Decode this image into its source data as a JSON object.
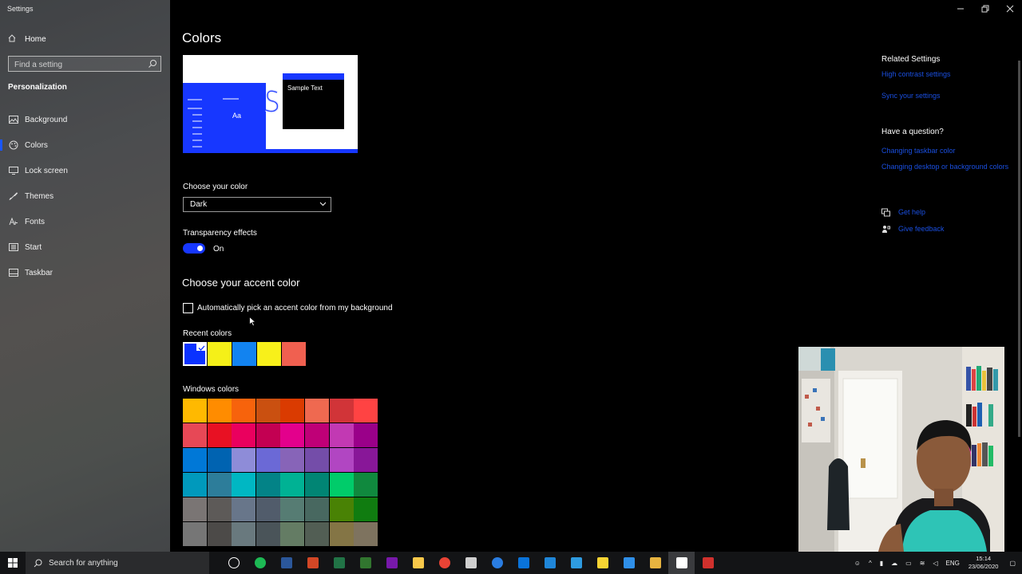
{
  "window": {
    "title": "Settings",
    "controls": [
      "minimize",
      "restore",
      "close"
    ]
  },
  "sidebar": {
    "home_label": "Home",
    "search_placeholder": "Find a setting",
    "section_label": "Personalization",
    "items": [
      {
        "label": "Background",
        "icon": "picture-icon"
      },
      {
        "label": "Colors",
        "icon": "palette-icon"
      },
      {
        "label": "Lock screen",
        "icon": "monitor-icon"
      },
      {
        "label": "Themes",
        "icon": "brush-icon"
      },
      {
        "label": "Fonts",
        "icon": "font-icon"
      },
      {
        "label": "Start",
        "icon": "start-menu-icon"
      },
      {
        "label": "Taskbar",
        "icon": "taskbar-icon"
      }
    ],
    "active_item": "Colors"
  },
  "main": {
    "title": "Colors",
    "preview": {
      "sample_text": "Sample Text",
      "aa_text": "Aa"
    },
    "choose_color": {
      "label": "Choose your color",
      "value": "Dark"
    },
    "transparency": {
      "label": "Transparency effects",
      "state": "On"
    },
    "accent": {
      "heading": "Choose your accent color",
      "auto_pick_label": "Automatically pick an accent color from my background",
      "auto_pick_checked": false,
      "recent_label": "Recent colors",
      "recent_colors": [
        "#0a32ff",
        "#f5f018",
        "#1283f0",
        "#f8f01a",
        "#f06050"
      ],
      "selected_recent_index": 0,
      "windows_label": "Windows colors",
      "windows_colors": [
        [
          "#ffb900",
          "#ff8c00",
          "#f7630c",
          "#ca5010",
          "#da3b01",
          "#ef6950",
          "#d13438",
          "#ff4343"
        ],
        [
          "#e74856",
          "#e81123",
          "#ea005e",
          "#c30052",
          "#e3008c",
          "#bf0077",
          "#c239b3",
          "#9a0089"
        ],
        [
          "#0078d7",
          "#0063b1",
          "#8e8cd8",
          "#6b69d6",
          "#8764b8",
          "#744da9",
          "#b146c2",
          "#881798"
        ],
        [
          "#0099bc",
          "#2d7d9a",
          "#00b7c3",
          "#038387",
          "#00b294",
          "#018574",
          "#00cc6a",
          "#10893e"
        ],
        [
          "#7a7574",
          "#5d5a58",
          "#68768a",
          "#515c6b",
          "#567c73",
          "#486860",
          "#498205",
          "#107c10"
        ],
        [
          "#767676",
          "#4c4a48",
          "#69797e",
          "#4a5459",
          "#647c64",
          "#525e54",
          "#847545",
          "#7e735f"
        ]
      ]
    }
  },
  "related": {
    "heading": "Related Settings",
    "links": [
      "High contrast settings",
      "Sync your settings"
    ],
    "question_heading": "Have a question?",
    "question_links": [
      "Changing taskbar color",
      "Changing desktop or background colors"
    ],
    "help_link": "Get help",
    "feedback_link": "Give feedback",
    "link_color": "#1a4fe0"
  },
  "taskbar": {
    "search_text": "Search for anything",
    "apps": [
      {
        "name": "cortana-icon",
        "color": "#ffffff"
      },
      {
        "name": "spotify-icon",
        "color": "#1db954"
      },
      {
        "name": "word-icon",
        "color": "#2b579a"
      },
      {
        "name": "powerpoint-icon",
        "color": "#d24726"
      },
      {
        "name": "excel-icon",
        "color": "#217346"
      },
      {
        "name": "project-icon",
        "color": "#31752f"
      },
      {
        "name": "onenote-icon",
        "color": "#7719aa"
      },
      {
        "name": "file-explorer-icon",
        "color": "#f8c84a"
      },
      {
        "name": "chrome-icon",
        "color": "#e94335"
      },
      {
        "name": "snip-icon",
        "color": "#cfcfcf"
      },
      {
        "name": "compass-icon",
        "color": "#2a7de1"
      },
      {
        "name": "store-icon",
        "color": "#0a73d9"
      },
      {
        "name": "window-app-icon",
        "color": "#1f86d8"
      },
      {
        "name": "paint-icon",
        "color": "#2e9be0"
      },
      {
        "name": "notes-icon",
        "color": "#f7d433"
      },
      {
        "name": "photos-icon",
        "color": "#2f8fe8"
      },
      {
        "name": "star-icon",
        "color": "#e6b340"
      },
      {
        "name": "settings-icon",
        "color": "#ffffff"
      },
      {
        "name": "calendar-icon",
        "color": "#d0312d"
      }
    ],
    "language": "ENG",
    "time": "15:14",
    "date": "23/06/2020"
  }
}
